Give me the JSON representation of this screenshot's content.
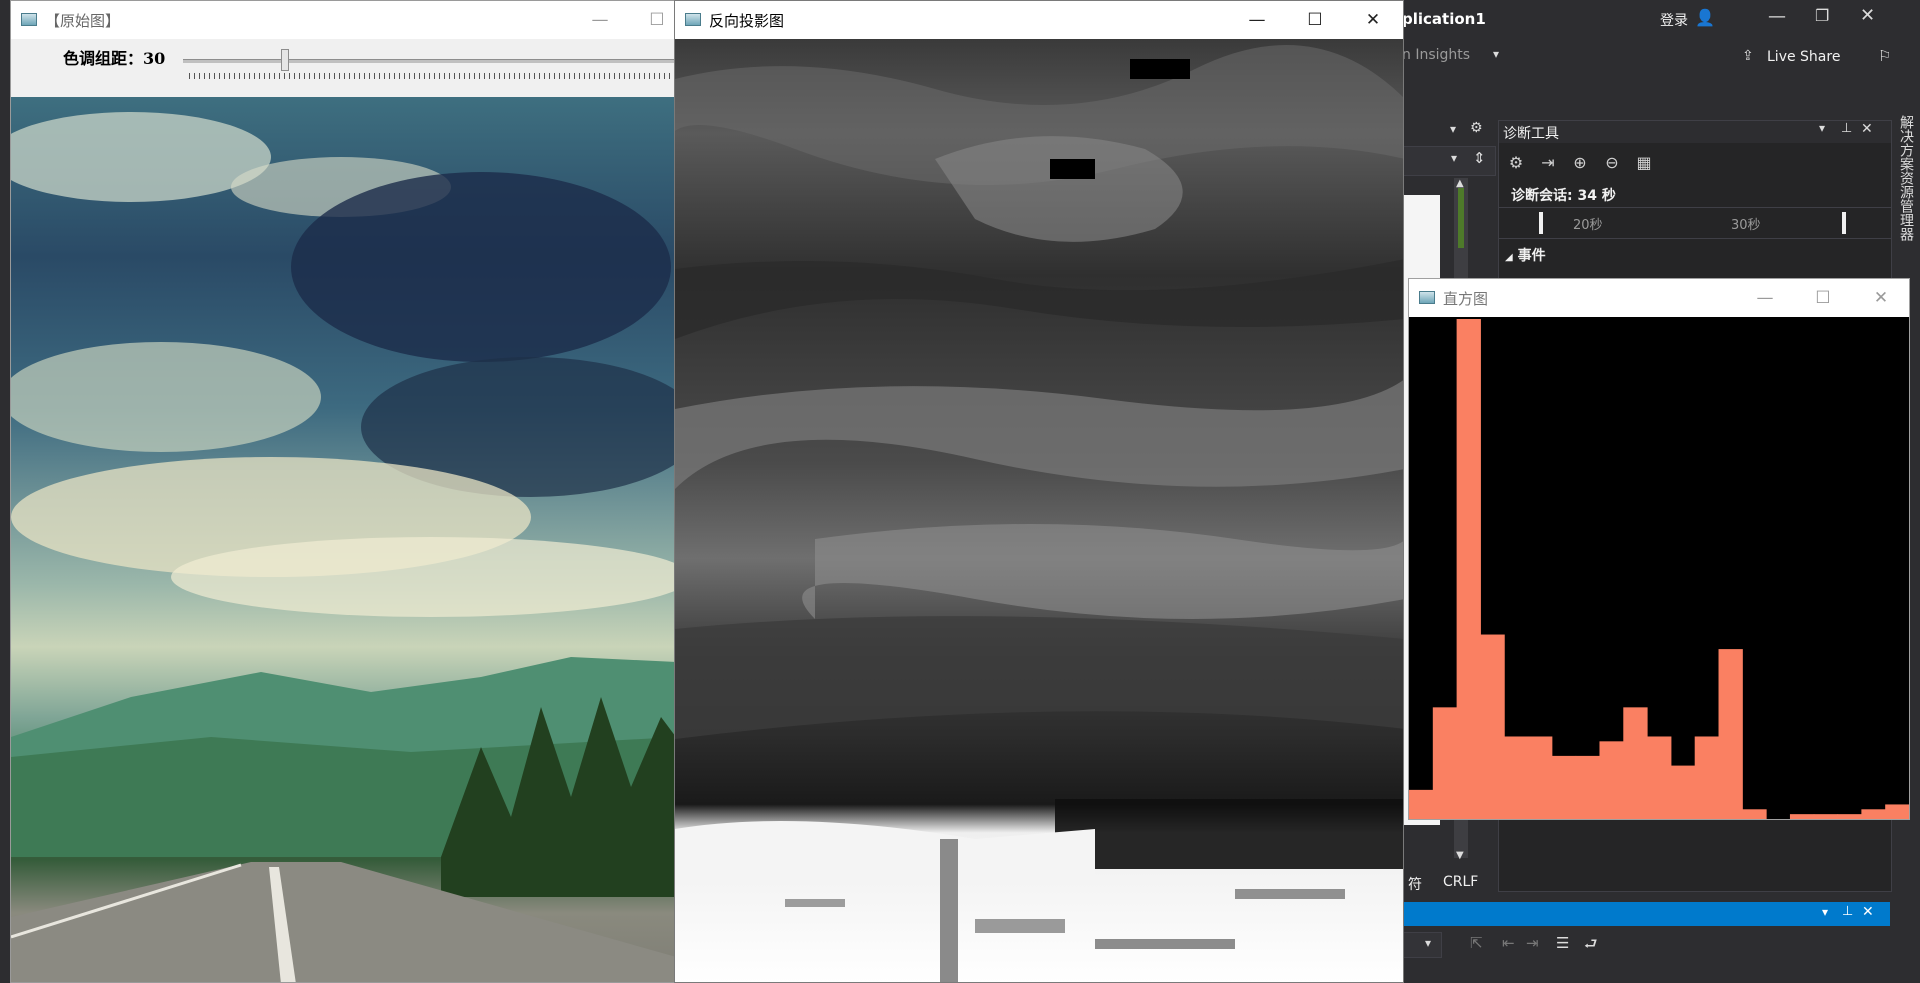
{
  "vs": {
    "title_fragment": "plication1",
    "login_label": "登录",
    "insights_fragment": "n Insights",
    "live_share_label": "Live Share",
    "diag_panel_title": "诊断工具",
    "diag_session": "诊断会话: 34 秒",
    "ruler_ticks": [
      "20秒",
      "30秒"
    ],
    "events_label": "事件",
    "side_tab_label": "解决方案资源管理器",
    "status_fragment": "符",
    "crlf_label": "CRLF"
  },
  "orig_window": {
    "title": "【原始图】",
    "trackbar_label": "色调组距：30",
    "trackbar_value": 30
  },
  "bp_window": {
    "title": "反向投影图"
  },
  "hist_window": {
    "title": "直方图",
    "bar_color": "#fa8062",
    "bars": [
      6,
      23,
      103,
      38,
      17,
      17,
      13,
      13,
      16,
      23,
      17,
      11,
      17,
      35,
      2,
      0,
      1,
      1,
      1,
      2,
      3
    ]
  }
}
